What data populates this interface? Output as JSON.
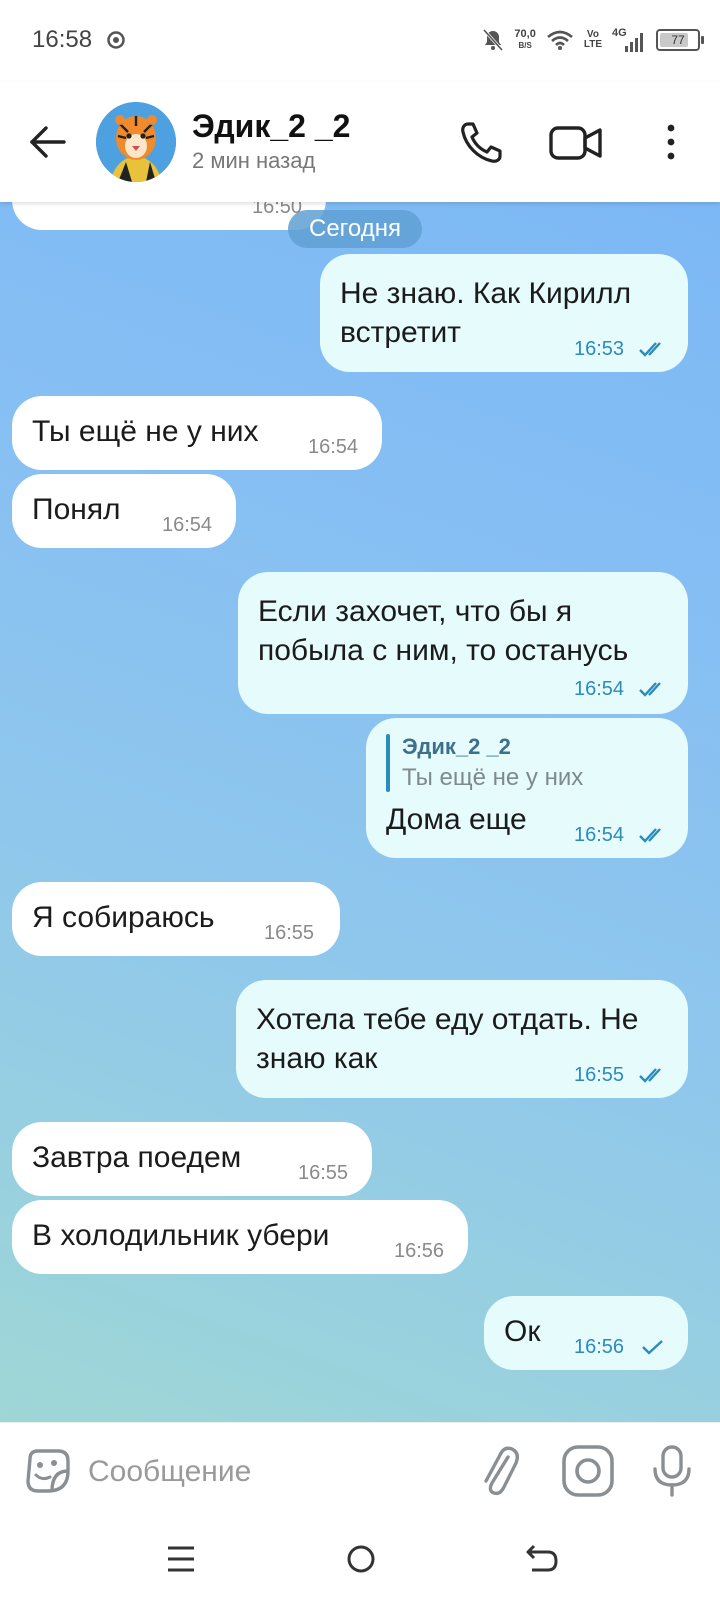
{
  "status_bar": {
    "time": "16:58",
    "net_speed_value": "70,0",
    "net_speed_unit": "B/S",
    "volte_top": "Vo",
    "volte_bottom": "LTE",
    "network": "4G",
    "battery": "77",
    "battery_level": 0.77
  },
  "header": {
    "contact_name": "Эдик_2 _2",
    "contact_status": "2 мин назад"
  },
  "chat": {
    "partial_time": "16:50",
    "date_label": "Сегодня",
    "messages": [
      {
        "direction": "out",
        "text": "Не знаю. Как Кирилл\nвстретит",
        "time": "16:53",
        "read": true
      },
      {
        "direction": "in",
        "text": "Ты ещё не у них",
        "time": "16:54"
      },
      {
        "direction": "in",
        "text": "Понял",
        "time": "16:54"
      },
      {
        "direction": "out",
        "text": "Если захочет, что бы я\nпобыла с ним, то останусь",
        "time": "16:54",
        "read": true
      },
      {
        "direction": "out",
        "reply_name": "Эдик_2 _2",
        "reply_text": "Ты ещё не у них",
        "text": "Дома еще",
        "time": "16:54",
        "read": true
      },
      {
        "direction": "in",
        "text": "Я собираюсь",
        "time": "16:55"
      },
      {
        "direction": "out",
        "text": "Хотела тебе еду отдать. Не\nзнаю как",
        "time": "16:55",
        "read": true
      },
      {
        "direction": "in",
        "text": "Завтра поедем",
        "time": "16:55"
      },
      {
        "direction": "in",
        "text": "В холодильник убери",
        "time": "16:56"
      },
      {
        "direction": "out",
        "text": "Ок",
        "time": "16:56",
        "read": false
      }
    ]
  },
  "input": {
    "placeholder": "Сообщение"
  },
  "icons": {
    "back": "arrow-left-icon",
    "call": "phone-icon",
    "video": "video-camera-icon",
    "more": "more-vertical-icon",
    "emoji": "sticker-icon",
    "attach": "paperclip-icon",
    "camera": "instagram-camera-icon",
    "mic": "microphone-icon"
  },
  "colors": {
    "outgoing_bubble": "#e6fbfb",
    "incoming_bubble": "#ffffff",
    "time_out": "#2a8bbd",
    "chat_bg_top": "#7cb8f5",
    "chat_bg_bottom": "#9fd7d6"
  }
}
